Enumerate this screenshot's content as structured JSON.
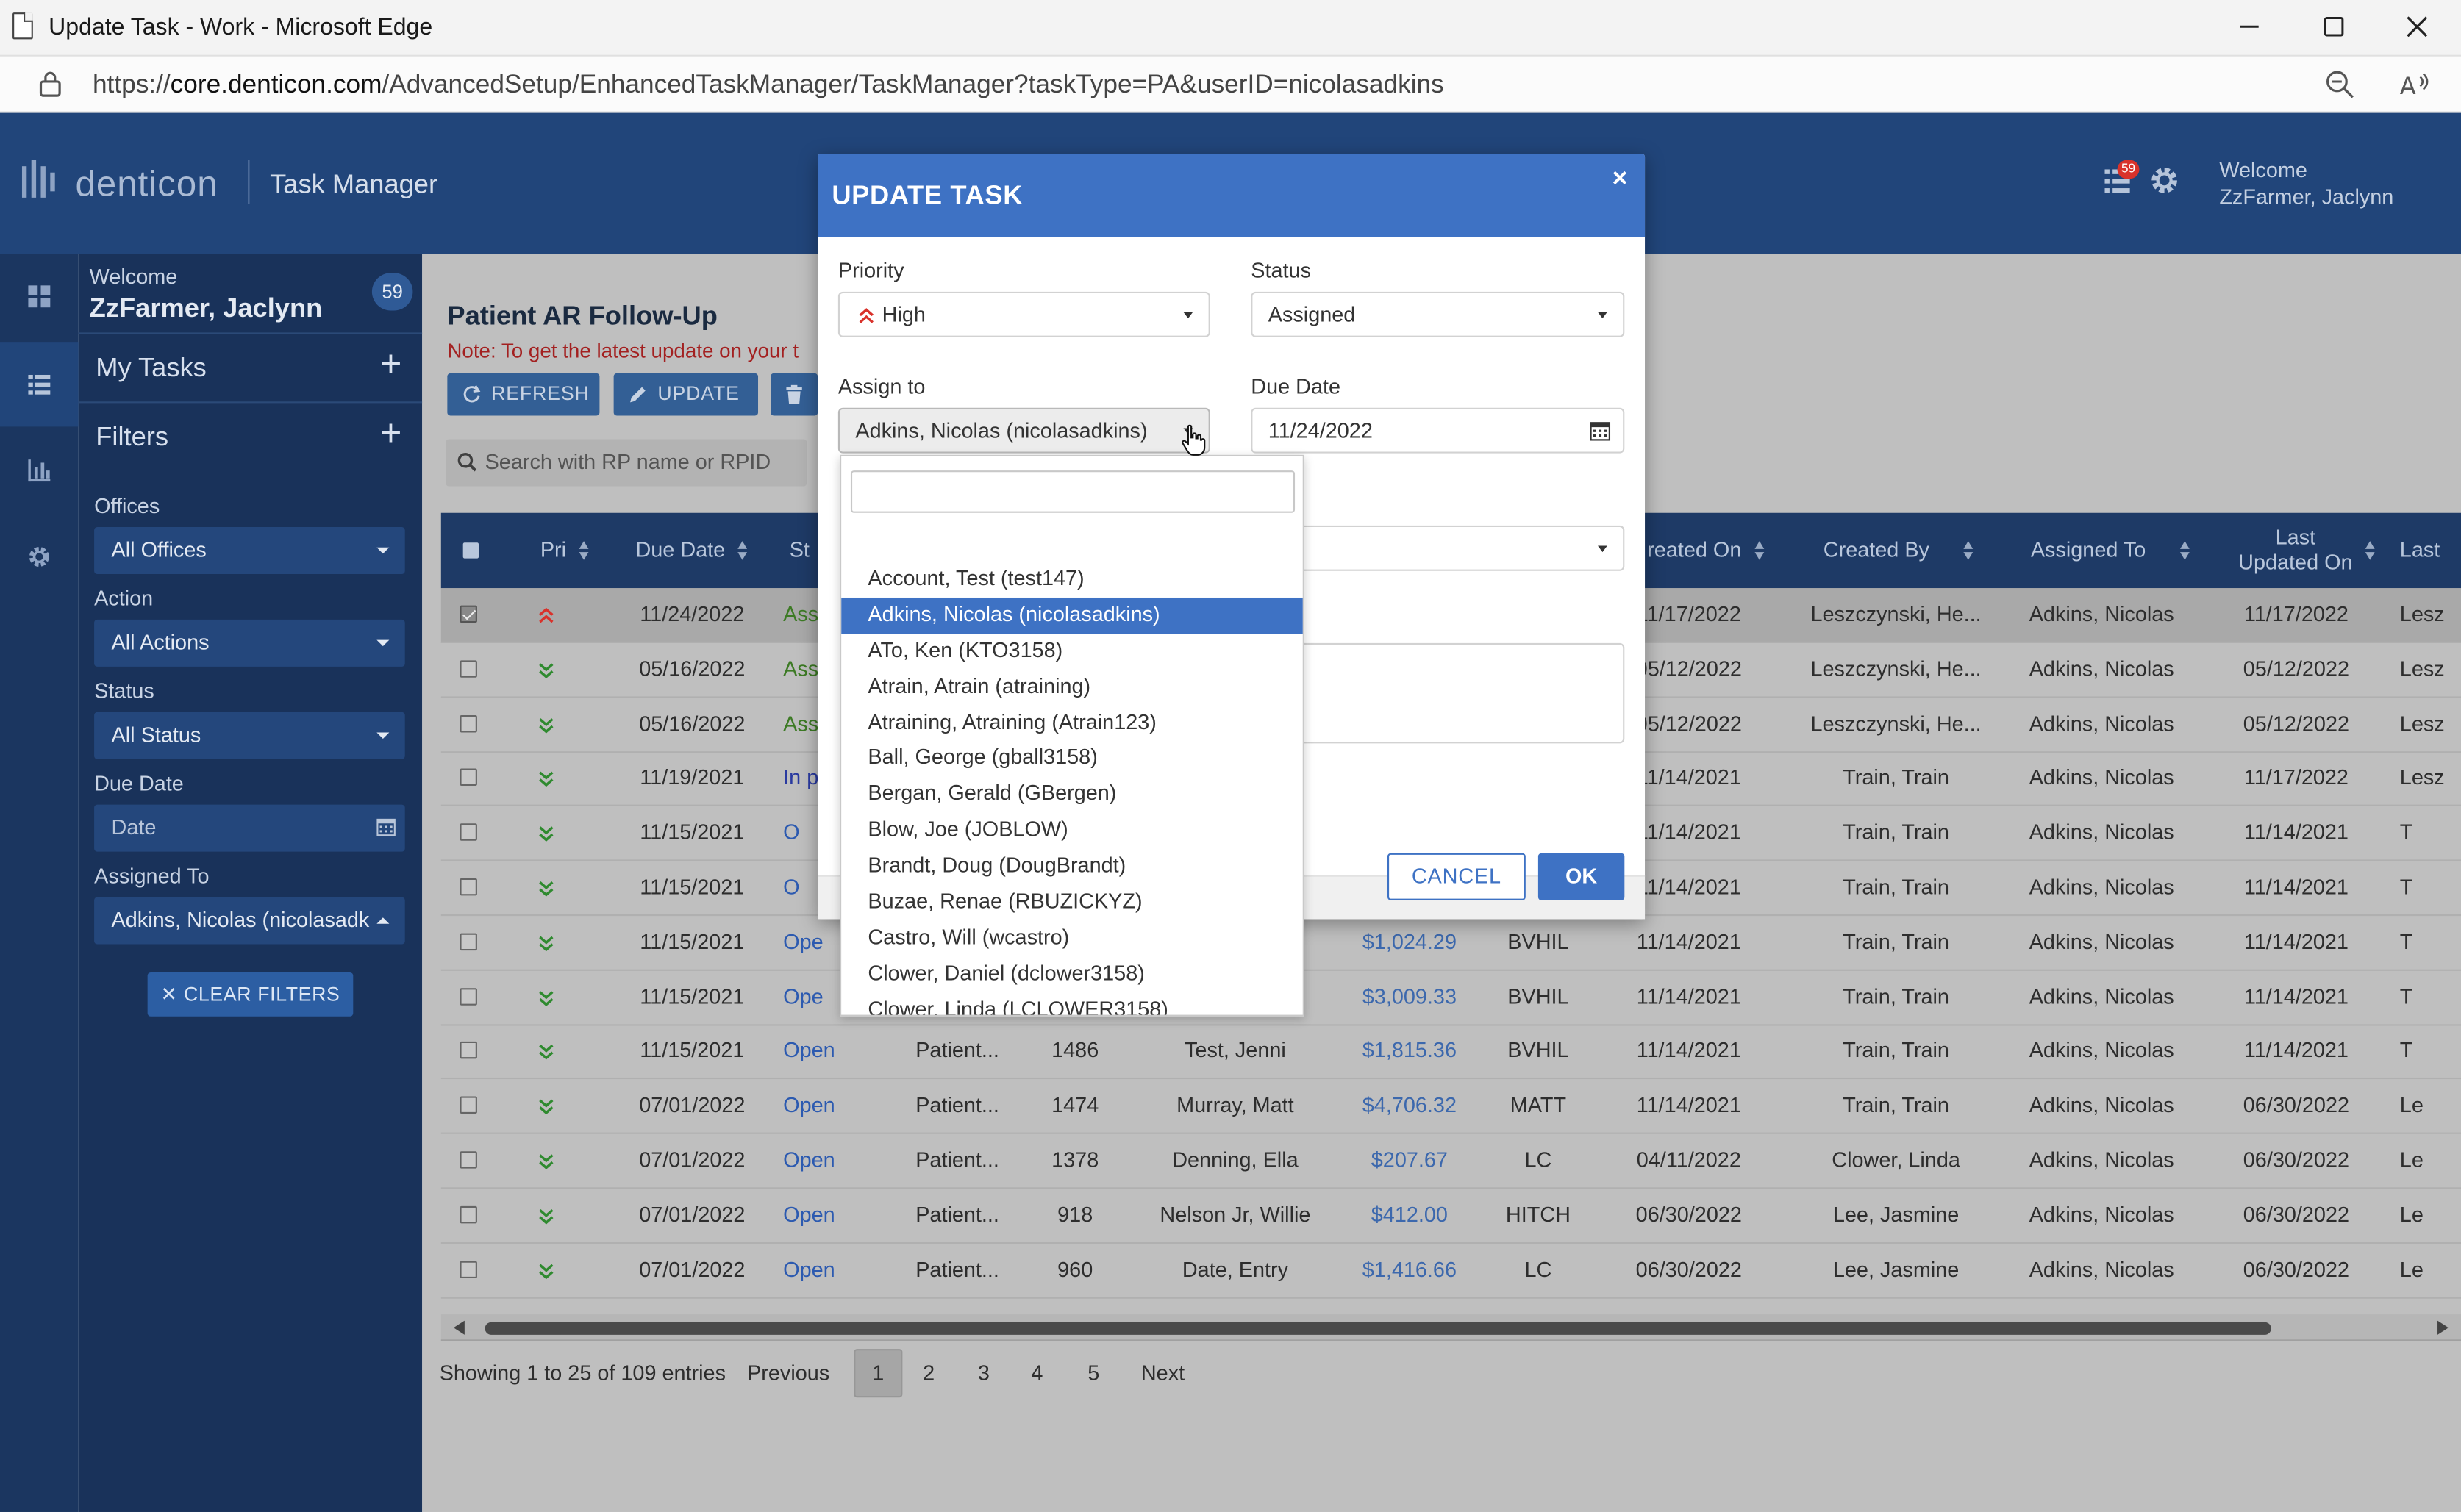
{
  "browser": {
    "window_title": "Update Task - Work - Microsoft Edge",
    "url_prefix": "https://",
    "url_host": "core.denticon.com",
    "url_path": "/AdvancedSetup/EnhancedTaskManager/TaskManager?taskType=PA&userID=nicolasadkins"
  },
  "header": {
    "logo": "denticon",
    "module": "Task Manager",
    "notification_count": "59",
    "welcome": "Welcome",
    "user": "ZzFarmer, Jaclynn"
  },
  "sidebar": {
    "welcome": "Welcome",
    "user": "ZzFarmer, Jaclynn",
    "badge": "59",
    "my_tasks": "My Tasks",
    "filters": "Filters",
    "offices_label": "Offices",
    "offices_value": "All Offices",
    "action_label": "Action",
    "action_value": "All Actions",
    "status_label": "Status",
    "status_value": "All Status",
    "due_label": "Due Date",
    "due_placeholder": "Date",
    "assigned_label": "Assigned To",
    "assigned_value": "Adkins, Nicolas (nicolasadk",
    "clear_filters": "CLEAR FILTERS"
  },
  "main": {
    "title": "Patient AR Follow-Up",
    "note": "Note: To get the latest update on your t",
    "refresh": "REFRESH",
    "update": "UPDATE",
    "search_placeholder": "Search with RP name or RPID",
    "columns": {
      "pri": "Pri",
      "due": "Due Date",
      "st": "St",
      "created_on": "reated On",
      "created_by": "Created By",
      "assigned_to": "Assigned To",
      "last_updated_1": "Last",
      "last_updated_2": "Updated On",
      "last": "Last"
    },
    "rows": [
      {
        "pri": "high",
        "due": "11/24/2022",
        "status": "Ass",
        "stype": "assigned",
        "type": "",
        "id": "",
        "name": "",
        "amount": "",
        "office": "",
        "created_on": "11/17/2022",
        "created_by": "Leszczynski, He...",
        "assigned_to": "Adkins, Nicolas",
        "updated": "11/17/2022",
        "last": "Lesz",
        "selected": true
      },
      {
        "pri": "low",
        "due": "05/16/2022",
        "status": "Ass",
        "stype": "assigned",
        "type": "",
        "id": "",
        "name": "",
        "amount": "",
        "office": "",
        "created_on": "05/12/2022",
        "created_by": "Leszczynski, He...",
        "assigned_to": "Adkins, Nicolas",
        "updated": "05/12/2022",
        "last": "Lesz"
      },
      {
        "pri": "low",
        "due": "05/16/2022",
        "status": "Ass",
        "stype": "assigned",
        "type": "",
        "id": "",
        "name": "",
        "amount": "",
        "office": "",
        "created_on": "05/12/2022",
        "created_by": "Leszczynski, He...",
        "assigned_to": "Adkins, Nicolas",
        "updated": "05/12/2022",
        "last": "Lesz"
      },
      {
        "pri": "low",
        "due": "11/19/2021",
        "status": "In p",
        "stype": "progress",
        "type": "",
        "id": "",
        "name": "",
        "amount": "",
        "office": "",
        "created_on": "11/14/2021",
        "created_by": "Train, Train",
        "assigned_to": "Adkins, Nicolas",
        "updated": "11/17/2022",
        "last": "Lesz"
      },
      {
        "pri": "low",
        "due": "11/15/2021",
        "status": "O",
        "stype": "open",
        "type": "",
        "id": "",
        "name": "",
        "amount": "",
        "office": "",
        "created_on": "11/14/2021",
        "created_by": "Train, Train",
        "assigned_to": "Adkins, Nicolas",
        "updated": "11/14/2021",
        "last": "T"
      },
      {
        "pri": "low",
        "due": "11/15/2021",
        "status": "O",
        "stype": "open",
        "type": "",
        "id": "",
        "name": "",
        "amount": "",
        "office": "",
        "created_on": "11/14/2021",
        "created_by": "Train, Train",
        "assigned_to": "Adkins, Nicolas",
        "updated": "11/14/2021",
        "last": "T"
      },
      {
        "pri": "low",
        "due": "11/15/2021",
        "status": "Ope",
        "stype": "open",
        "type": "",
        "id": "",
        "name": "",
        "amount": "$1,024.29",
        "office": "BVHIL",
        "created_on": "11/14/2021",
        "created_by": "Train, Train",
        "assigned_to": "Adkins, Nicolas",
        "updated": "11/14/2021",
        "last": "T"
      },
      {
        "pri": "low",
        "due": "11/15/2021",
        "status": "Ope",
        "stype": "open",
        "type": "",
        "id": "",
        "name": "",
        "amount": "$3,009.33",
        "office": "BVHIL",
        "created_on": "11/14/2021",
        "created_by": "Train, Train",
        "assigned_to": "Adkins, Nicolas",
        "updated": "11/14/2021",
        "last": "T"
      },
      {
        "pri": "low",
        "due": "11/15/2021",
        "status": "Open",
        "stype": "open",
        "type": "Patient...",
        "id": "1486",
        "name": "Test, Jenni",
        "amount": "$1,815.36",
        "office": "BVHIL",
        "created_on": "11/14/2021",
        "created_by": "Train, Train",
        "assigned_to": "Adkins, Nicolas",
        "updated": "11/14/2021",
        "last": "T"
      },
      {
        "pri": "low",
        "due": "07/01/2022",
        "status": "Open",
        "stype": "open",
        "type": "Patient...",
        "id": "1474",
        "name": "Murray, Matt",
        "amount": "$4,706.32",
        "office": "MATT",
        "created_on": "11/14/2021",
        "created_by": "Train, Train",
        "assigned_to": "Adkins, Nicolas",
        "updated": "06/30/2022",
        "last": "Le"
      },
      {
        "pri": "low",
        "due": "07/01/2022",
        "status": "Open",
        "stype": "open",
        "type": "Patient...",
        "id": "1378",
        "name": "Denning, Ella",
        "amount": "$207.67",
        "office": "LC",
        "created_on": "04/11/2022",
        "created_by": "Clower, Linda",
        "assigned_to": "Adkins, Nicolas",
        "updated": "06/30/2022",
        "last": "Le"
      },
      {
        "pri": "low",
        "due": "07/01/2022",
        "status": "Open",
        "stype": "open",
        "type": "Patient...",
        "id": "918",
        "name": "Nelson Jr, Willie",
        "amount": "$412.00",
        "office": "HITCH",
        "created_on": "06/30/2022",
        "created_by": "Lee, Jasmine",
        "assigned_to": "Adkins, Nicolas",
        "updated": "06/30/2022",
        "last": "Le"
      },
      {
        "pri": "low",
        "due": "07/01/2022",
        "status": "Open",
        "stype": "open",
        "type": "Patient...",
        "id": "960",
        "name": "Date, Entry",
        "amount": "$1,416.66",
        "office": "LC",
        "created_on": "06/30/2022",
        "created_by": "Lee, Jasmine",
        "assigned_to": "Adkins, Nicolas",
        "updated": "06/30/2022",
        "last": "Le"
      }
    ],
    "pager": {
      "info": "Showing 1 to 25 of 109 entries",
      "previous": "Previous",
      "pages": [
        "1",
        "2",
        "3",
        "4",
        "5"
      ],
      "next": "Next"
    }
  },
  "modal": {
    "title": "UPDATE TASK",
    "close": "×",
    "priority_label": "Priority",
    "priority_value": "High",
    "status_label": "Status",
    "status_value": "Assigned",
    "assign_label": "Assign to",
    "assign_value": "Adkins, Nicolas (nicolasadkins)",
    "due_label": "Due Date",
    "due_value": "11/24/2022",
    "cancel": "CANCEL",
    "ok": "OK"
  },
  "dropdown": {
    "search_value": "",
    "items": [
      "Account, Test (test147)",
      "Adkins, Nicolas (nicolasadkins)",
      "ATo, Ken (KTO3158)",
      "Atrain, Atrain (atraining)",
      "Atraining, Atraining (Atrain123)",
      "Ball, George (gball3158)",
      "Bergan, Gerald (GBergen)",
      "Blow, Joe (JOBLOW)",
      "Brandt, Doug (DougBrandt)",
      "Buzae, Renae (RBUZICKYZ)",
      "Castro, Will (wcastro)",
      "Clower, Daniel (dclower3158)",
      "Clower, Linda (LCLOWER3158)"
    ],
    "highlighted": 1
  },
  "colors": {
    "header": "#21457a",
    "sidebar": "#19325a",
    "accent": "#3e72c4",
    "high_priority": "#d9322b",
    "low_priority": "#2f8a2f"
  }
}
